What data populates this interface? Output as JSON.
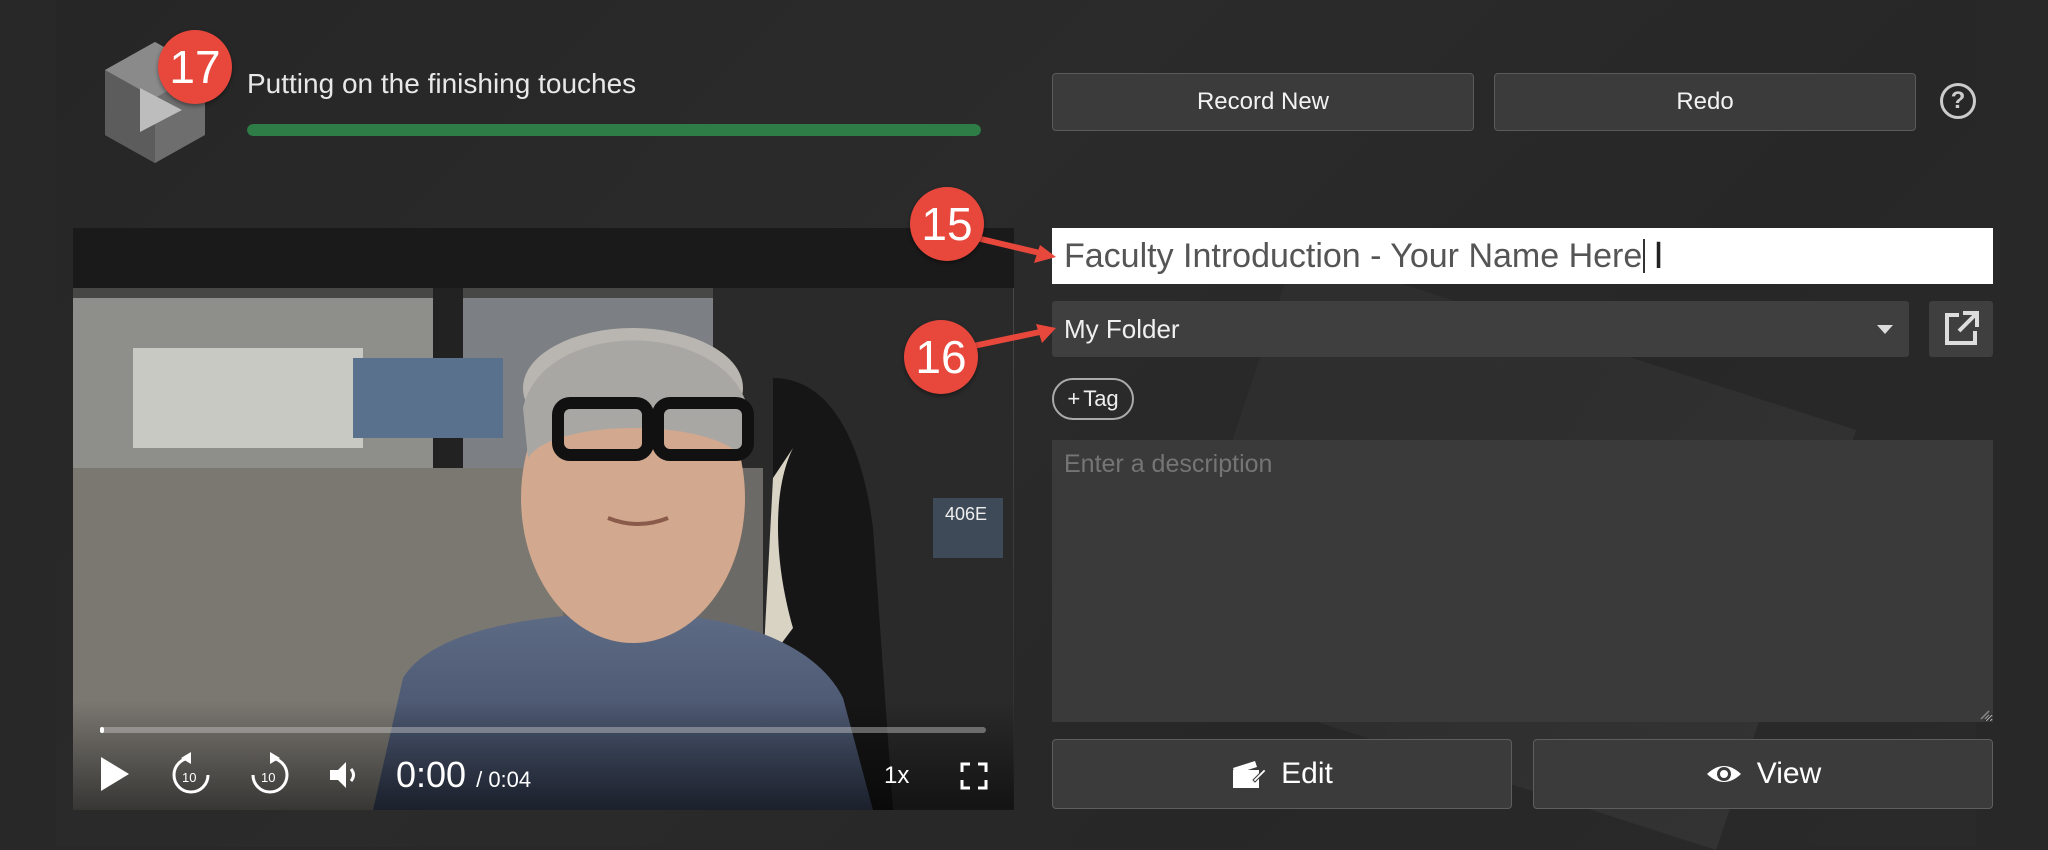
{
  "header": {
    "status_text": "Putting on the finishing touches",
    "progress": 1.0,
    "record_new_label": "Record New",
    "redo_label": "Redo",
    "help_icon": "help-circle-icon",
    "help_glyph": "?"
  },
  "video": {
    "current_time": "0:00",
    "duration": "/ 0:04",
    "speed": "1x",
    "playback_progress": 0.0,
    "rewind_seconds": "10",
    "forward_seconds": "10",
    "wall_sign": "406E"
  },
  "form": {
    "title_value": "Faculty Introduction - Your Name Here",
    "folder_value": "My Folder",
    "tag_label": "Tag",
    "tag_plus": "+",
    "description_placeholder": "Enter a description"
  },
  "actions": {
    "edit_label": "Edit",
    "view_label": "View"
  },
  "annotations": {
    "badge_a": "17",
    "badge_b": "15",
    "badge_c": "16"
  },
  "colors": {
    "progress": "#2e7d46",
    "badge": "#e8473c",
    "background": "#282828"
  }
}
